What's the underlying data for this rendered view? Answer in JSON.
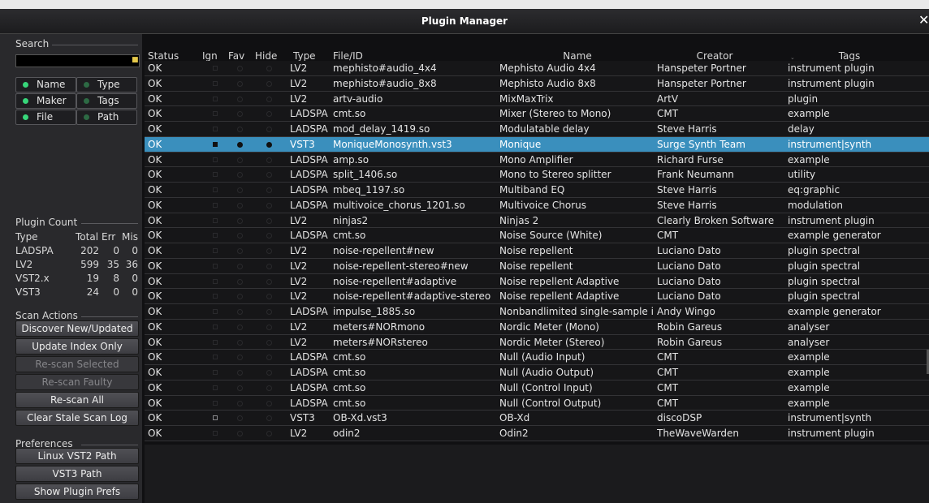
{
  "window": {
    "title": "Plugin Manager",
    "close_glyph": "✕"
  },
  "sidebar": {
    "search_label": "Search",
    "search_value": "",
    "lock_icon": "lock-icon",
    "filters": [
      {
        "label": "Name",
        "on": true
      },
      {
        "label": "Type",
        "on": false
      },
      {
        "label": "Maker",
        "on": true
      },
      {
        "label": "Tags",
        "on": false
      },
      {
        "label": "File",
        "on": true
      },
      {
        "label": "Path",
        "on": false
      }
    ],
    "plugin_count_label": "Plugin Count",
    "count_headers": [
      "Type",
      "Total",
      "Err",
      "Mis"
    ],
    "counts": [
      {
        "type": "LADSPA",
        "total": "202",
        "err": "0",
        "mis": "0"
      },
      {
        "type": "LV2",
        "total": "599",
        "err": "35",
        "mis": "36"
      },
      {
        "type": "VST2.x",
        "total": "19",
        "err": "8",
        "mis": "0"
      },
      {
        "type": "VST3",
        "total": "24",
        "err": "0",
        "mis": "0"
      }
    ],
    "scan_actions_label": "Scan Actions",
    "scan_buttons": [
      {
        "label": "Discover New/Updated",
        "enabled": true
      },
      {
        "label": "Update Index Only",
        "enabled": true
      },
      {
        "label": "Re-scan Selected",
        "enabled": false
      },
      {
        "label": "Re-scan Faulty",
        "enabled": false
      },
      {
        "label": "Re-scan All",
        "enabled": true
      },
      {
        "label": "Clear Stale Scan Log",
        "enabled": true
      }
    ],
    "preferences_label": "Preferences",
    "pref_buttons": [
      {
        "label": "Linux VST2 Path"
      },
      {
        "label": "VST3 Path"
      },
      {
        "label": "Show Plugin Prefs"
      }
    ]
  },
  "table": {
    "headers": {
      "status": "Status",
      "ign": "Ign",
      "fav": "Fav",
      "hide": "Hide",
      "type": "Type",
      "file": "File/ID",
      "name": "Name",
      "creator": "Creator",
      "tags": "Tags"
    },
    "selected_index": 5,
    "rows": [
      {
        "status": "OK",
        "type": "LV2",
        "file": "mephisto#audio_4x4",
        "name": "Mephisto Audio 4x4",
        "creator": "Hanspeter Portner",
        "tags": "instrument plugin"
      },
      {
        "status": "OK",
        "type": "LV2",
        "file": "mephisto#audio_8x8",
        "name": "Mephisto Audio 8x8",
        "creator": "Hanspeter Portner",
        "tags": "instrument plugin"
      },
      {
        "status": "OK",
        "type": "LV2",
        "file": "artv-audio",
        "name": "MixMaxTrix",
        "creator": "ArtV",
        "tags": "plugin"
      },
      {
        "status": "OK",
        "type": "LADSPA",
        "file": "cmt.so",
        "name": "Mixer (Stereo to Mono)",
        "creator": "CMT",
        "tags": "example"
      },
      {
        "status": "OK",
        "type": "LADSPA",
        "file": "mod_delay_1419.so",
        "name": "Modulatable delay",
        "creator": "Steve Harris",
        "tags": "delay"
      },
      {
        "status": "OK",
        "type": "VST3",
        "file": "MoniqueMonosynth.vst3",
        "name": "Monique",
        "creator": "Surge Synth Team",
        "tags": "instrument|synth"
      },
      {
        "status": "OK",
        "type": "LADSPA",
        "file": "amp.so",
        "name": "Mono Amplifier",
        "creator": "Richard Furse",
        "tags": "example"
      },
      {
        "status": "OK",
        "type": "LADSPA",
        "file": "split_1406.so",
        "name": "Mono to Stereo splitter",
        "creator": "Frank Neumann",
        "tags": "utility"
      },
      {
        "status": "OK",
        "type": "LADSPA",
        "file": "mbeq_1197.so",
        "name": "Multiband EQ",
        "creator": "Steve Harris",
        "tags": "eq:graphic"
      },
      {
        "status": "OK",
        "type": "LADSPA",
        "file": "multivoice_chorus_1201.so",
        "name": "Multivoice Chorus",
        "creator": "Steve Harris",
        "tags": "modulation"
      },
      {
        "status": "OK",
        "type": "LV2",
        "file": "ninjas2",
        "name": "Ninjas 2",
        "creator": "Clearly Broken Software",
        "tags": "instrument plugin"
      },
      {
        "status": "OK",
        "type": "LADSPA",
        "file": "cmt.so",
        "name": "Noise Source (White)",
        "creator": "CMT",
        "tags": "example generator"
      },
      {
        "status": "OK",
        "type": "LV2",
        "file": "noise-repellent#new",
        "name": "Noise repellent",
        "creator": "Luciano Dato",
        "tags": "plugin spectral"
      },
      {
        "status": "OK",
        "type": "LV2",
        "file": "noise-repellent-stereo#new",
        "name": "Noise repellent",
        "creator": "Luciano Dato",
        "tags": "plugin spectral"
      },
      {
        "status": "OK",
        "type": "LV2",
        "file": "noise-repellent#adaptive",
        "name": "Noise repellent Adaptive",
        "creator": "Luciano Dato",
        "tags": "plugin spectral"
      },
      {
        "status": "OK",
        "type": "LV2",
        "file": "noise-repellent#adaptive-stereo",
        "name": "Noise repellent Adaptive",
        "creator": "Luciano Dato",
        "tags": "plugin spectral"
      },
      {
        "status": "OK",
        "type": "LADSPA",
        "file": "impulse_1885.so",
        "name": "Nonbandlimited single-sample i",
        "creator": "Andy Wingo",
        "tags": "example generator"
      },
      {
        "status": "OK",
        "type": "LV2",
        "file": "meters#NORmono",
        "name": "Nordic Meter (Mono)",
        "creator": "Robin Gareus",
        "tags": "analyser"
      },
      {
        "status": "OK",
        "type": "LV2",
        "file": "meters#NORstereo",
        "name": "Nordic Meter (Stereo)",
        "creator": "Robin Gareus",
        "tags": "analyser"
      },
      {
        "status": "OK",
        "type": "LADSPA",
        "file": "cmt.so",
        "name": "Null (Audio Input)",
        "creator": "CMT",
        "tags": "example"
      },
      {
        "status": "OK",
        "type": "LADSPA",
        "file": "cmt.so",
        "name": "Null (Audio Output)",
        "creator": "CMT",
        "tags": "example"
      },
      {
        "status": "OK",
        "type": "LADSPA",
        "file": "cmt.so",
        "name": "Null (Control Input)",
        "creator": "CMT",
        "tags": "example"
      },
      {
        "status": "OK",
        "type": "LADSPA",
        "file": "cmt.so",
        "name": "Null (Control Output)",
        "creator": "CMT",
        "tags": "example"
      },
      {
        "status": "OK",
        "type": "VST3",
        "file": "OB-Xd.vst3",
        "name": "OB-Xd",
        "creator": "discoDSP",
        "tags": "instrument|synth",
        "ign_hl": true
      },
      {
        "status": "OK",
        "type": "LV2",
        "file": "odin2",
        "name": "Odin2",
        "creator": "TheWaveWarden",
        "tags": "instrument plugin"
      }
    ]
  },
  "colors": {
    "selection": "#3a8fbd",
    "led_on": "#37d67a"
  }
}
